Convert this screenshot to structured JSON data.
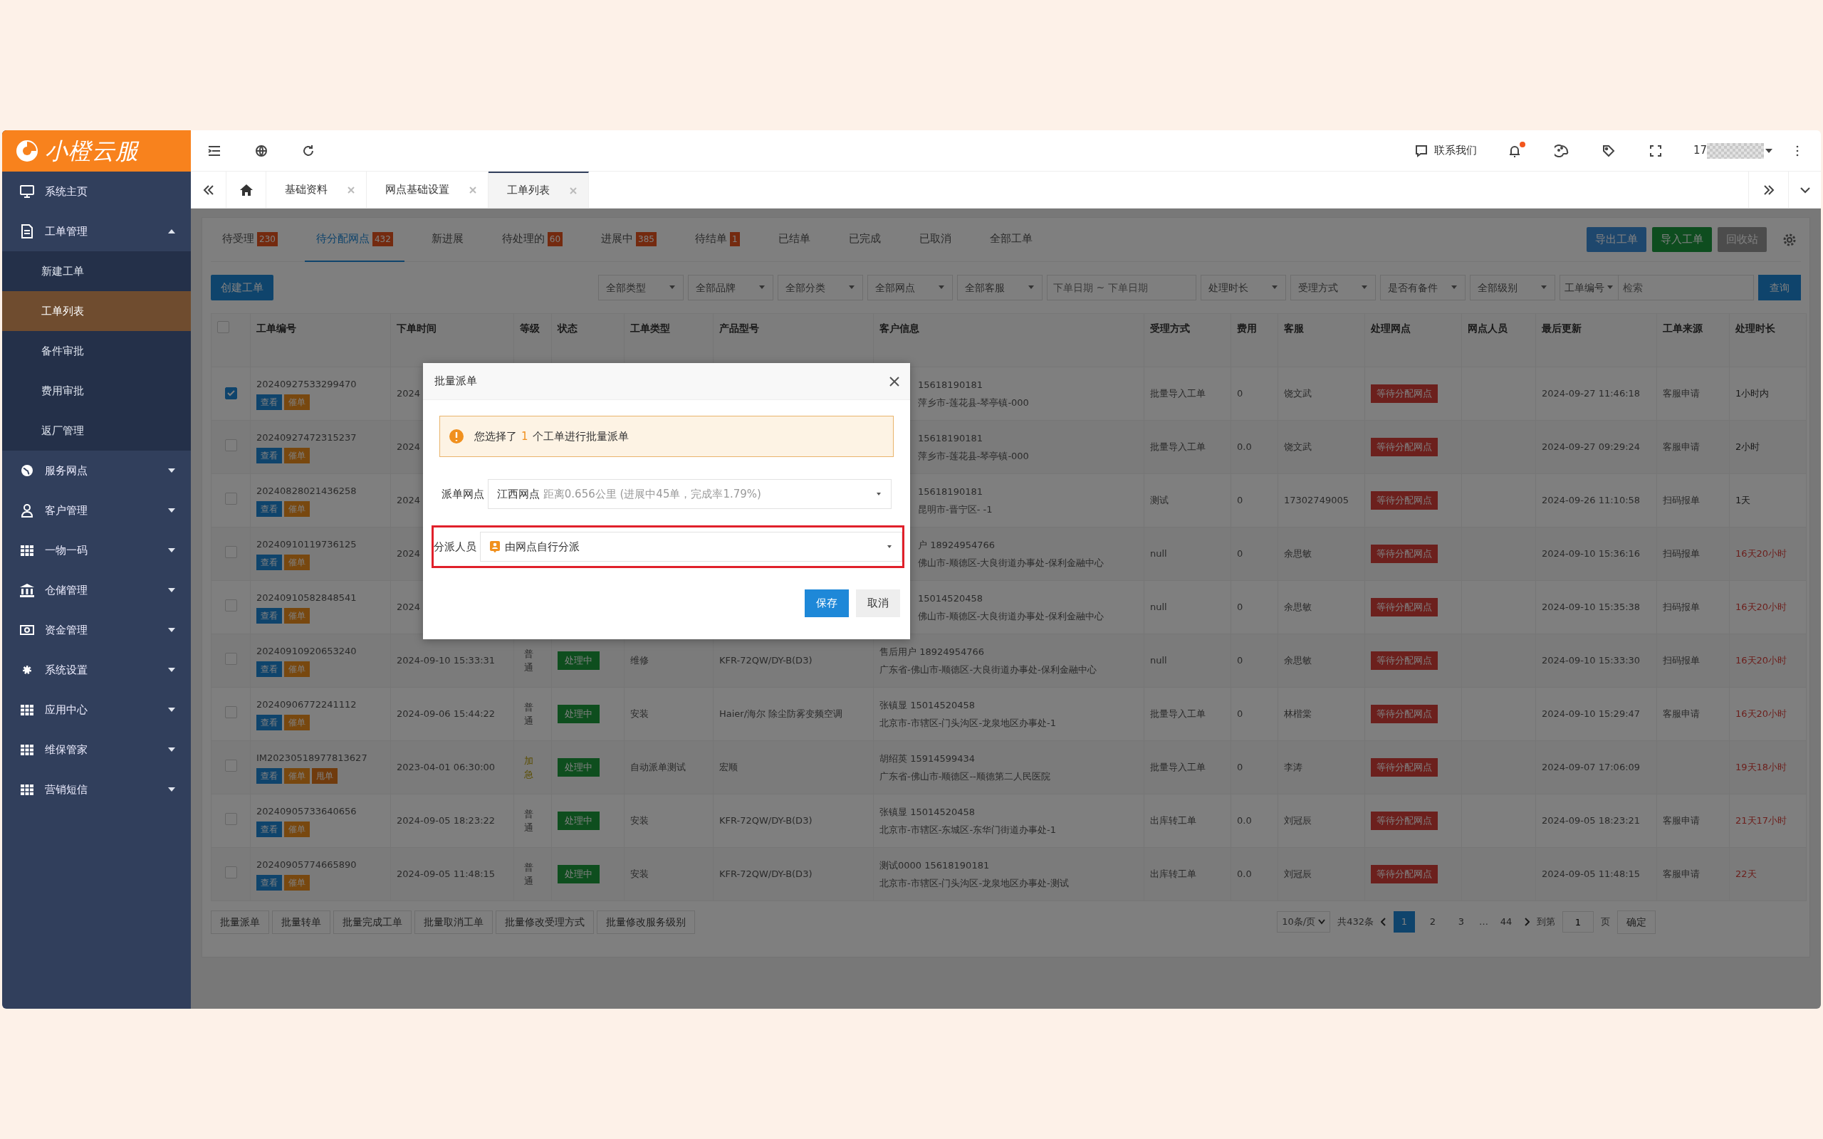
{
  "logo": {
    "text": "小橙云服"
  },
  "sidebar": {
    "items": [
      {
        "label": "系统主页"
      },
      {
        "label": "工单管理",
        "expanded": true,
        "children": [
          {
            "label": "新建工单",
            "selected": false
          },
          {
            "label": "工单列表",
            "selected": true
          },
          {
            "label": "备件审批",
            "selected": false
          },
          {
            "label": "费用审批",
            "selected": false
          },
          {
            "label": "返厂管理",
            "selected": false
          }
        ]
      },
      {
        "label": "服务网点",
        "expanded": false
      },
      {
        "label": "客户管理",
        "expanded": false
      },
      {
        "label": "一物一码",
        "expanded": false
      },
      {
        "label": "仓储管理",
        "expanded": false
      },
      {
        "label": "资金管理",
        "expanded": false
      },
      {
        "label": "系统设置",
        "expanded": false
      },
      {
        "label": "应用中心",
        "expanded": false
      },
      {
        "label": "维保管家",
        "expanded": false
      },
      {
        "label": "营销短信",
        "expanded": false
      }
    ]
  },
  "header": {
    "contact": "联系我们",
    "notification_dot": true,
    "user": "17"
  },
  "page_tabs": [
    {
      "label": "基础资料",
      "selected": false
    },
    {
      "label": "网点基础设置",
      "selected": false
    },
    {
      "label": "工单列表",
      "selected": true
    }
  ],
  "status_tabs": [
    {
      "label": "待受理",
      "count": "230",
      "selected": false
    },
    {
      "label": "待分配网点",
      "count": "432",
      "selected": true
    },
    {
      "label": "新进展",
      "selected": false
    },
    {
      "label": "待处理的",
      "count": "60",
      "selected": false
    },
    {
      "label": "进展中",
      "count": "385",
      "selected": false
    },
    {
      "label": "待结单",
      "count": "1",
      "selected": false
    },
    {
      "label": "已结单",
      "selected": false
    },
    {
      "label": "已完成",
      "selected": false
    },
    {
      "label": "已取消",
      "selected": false
    },
    {
      "label": "全部工单",
      "selected": false
    }
  ],
  "toolbar_buttons": [
    {
      "label": "导出工单",
      "kind": "export"
    },
    {
      "label": "导入工单",
      "kind": "import"
    },
    {
      "label": "回收站",
      "kind": "recycle"
    }
  ],
  "create_button": "创建工单",
  "filters": [
    {
      "label": "全部类型"
    },
    {
      "label": "全部品牌"
    },
    {
      "label": "全部分类"
    },
    {
      "label": "全部网点"
    },
    {
      "label": "全部客服"
    },
    {
      "placeholder": "下单日期 ~ 下单日期",
      "kind": "date"
    },
    {
      "label": "处理时长"
    },
    {
      "label": "受理方式"
    },
    {
      "label": "是否有备件"
    },
    {
      "label": "全部级别"
    }
  ],
  "search": {
    "field": "工单编号",
    "placeholder": "检索",
    "button": "查询"
  },
  "table": {
    "select_all_checked": false,
    "columns": [
      "工单编号",
      "下单时间",
      "等级",
      "状态",
      "工单类型",
      "产品型号",
      "客户信息",
      "受理方式",
      "费用",
      "客服",
      "处理网点",
      "网点人员",
      "最后更新",
      "工单来源",
      "处理时长"
    ],
    "rows": [
      {
        "checked": true,
        "covered": true,
        "number": "20240927533299470",
        "actions": [
          {
            "label": "查看",
            "kind": "view"
          },
          {
            "label": "催单",
            "kind": "remind"
          }
        ],
        "time": "2024",
        "customer": [
          "15618190181",
          "萍乡市-莲花县-琴亭镇-000"
        ],
        "method": "批量导入工单",
        "fee": "0",
        "agent": "饶文武",
        "site": "等待分配网点",
        "updated": "2024-09-27 11:46:18",
        "source": "客服申请",
        "duration": "1小时内",
        "overdue": false
      },
      {
        "checked": false,
        "covered": true,
        "number": "20240927472315237",
        "actions": [
          {
            "label": "查看",
            "kind": "view"
          },
          {
            "label": "催单",
            "kind": "remind"
          }
        ],
        "time": "2024",
        "customer": [
          "15618190181",
          "萍乡市-莲花县-琴亭镇-000"
        ],
        "method": "批量导入工单",
        "fee": "0.0",
        "agent": "饶文武",
        "site": "等待分配网点",
        "updated": "2024-09-27 09:29:24",
        "source": "客服申请",
        "duration": "2小时",
        "overdue": false
      },
      {
        "checked": false,
        "covered": true,
        "number": "20240828021436258",
        "actions": [
          {
            "label": "查看",
            "kind": "view"
          },
          {
            "label": "催单",
            "kind": "remind"
          }
        ],
        "time": "2024",
        "customer": [
          "15618190181",
          "昆明市-晋宁区- -1"
        ],
        "method": "测试",
        "fee": "0",
        "agent": "17302749005",
        "site": "等待分配网点",
        "updated": "2024-09-26 11:10:58",
        "source": "扫码报单",
        "duration": "1天",
        "overdue": false
      },
      {
        "checked": false,
        "covered": true,
        "number": "20240910119736125",
        "actions": [
          {
            "label": "查看",
            "kind": "view"
          },
          {
            "label": "催单",
            "kind": "remind"
          }
        ],
        "time": "2024",
        "customer": [
          "户 18924954766",
          "佛山市-顺德区-大良街道办事处-保利金融中心"
        ],
        "method": "null",
        "fee": "0",
        "agent": "余思敏",
        "site": "等待分配网点",
        "updated": "2024-09-10 15:36:16",
        "source": "扫码报单",
        "duration": "16天20小时",
        "overdue": true
      },
      {
        "checked": false,
        "covered": true,
        "number": "20240910582848541",
        "actions": [
          {
            "label": "查看",
            "kind": "view"
          },
          {
            "label": "催单",
            "kind": "remind"
          }
        ],
        "time": "2024",
        "customer": [
          "15014520458",
          "佛山市-顺德区-大良街道办事处-保利金融中心"
        ],
        "method": "null",
        "fee": "0",
        "agent": "余思敏",
        "site": "等待分配网点",
        "updated": "2024-09-10 15:35:38",
        "source": "扫码报单",
        "duration": "16天20小时",
        "overdue": true
      },
      {
        "checked": false,
        "covered": false,
        "number": "20240910920653240",
        "actions": [
          {
            "label": "查看",
            "kind": "view"
          },
          {
            "label": "催单",
            "kind": "remind"
          }
        ],
        "time": "2024-09-10 15:33:31",
        "priority": "普通",
        "urgent": false,
        "status": "处理中",
        "type": "维修",
        "model": "KFR-72QW/DY-B(D3)",
        "customer": [
          "售后用户 18924954766",
          "广东省-佛山市-顺德区-大良街道办事处-保利金融中心"
        ],
        "method": "null",
        "fee": "0",
        "agent": "余思敏",
        "site": "等待分配网点",
        "updated": "2024-09-10 15:33:30",
        "source": "扫码报单",
        "duration": "16天20小时",
        "overdue": true
      },
      {
        "checked": false,
        "covered": false,
        "number": "20240906772241112",
        "actions": [
          {
            "label": "查看",
            "kind": "view"
          },
          {
            "label": "催单",
            "kind": "remind"
          }
        ],
        "time": "2024-09-06 15:44:22",
        "priority": "普通",
        "urgent": false,
        "status": "处理中",
        "type": "安装",
        "model": "Haier/海尔 除尘防雾变频空调",
        "customer": [
          "张镇显 15014520458",
          "北京市-市辖区-门头沟区-龙泉地区办事处-1"
        ],
        "method": "批量导入工单",
        "fee": "0",
        "agent": "林楷棠",
        "site": "等待分配网点",
        "updated": "2024-09-10 15:29:47",
        "source": "客服申请",
        "duration": "16天20小时",
        "overdue": true
      },
      {
        "checked": false,
        "covered": false,
        "number": "IM20230518977813627",
        "actions": [
          {
            "label": "查看",
            "kind": "view"
          },
          {
            "label": "催单",
            "kind": "remind"
          },
          {
            "label": "甩单",
            "kind": "transfer"
          }
        ],
        "time": "2023-04-01 06:30:00",
        "priority": "加急",
        "urgent": true,
        "status": "处理中",
        "type": "自动派单测试",
        "model": "宏顺",
        "customer": [
          "胡绍英 15914599434",
          "广东省-佛山市-顺德区--顺德第二人民医院"
        ],
        "method": "批量导入工单",
        "fee": "0",
        "agent": "李涛",
        "site": "等待分配网点",
        "updated": "2024-09-07 17:06:09",
        "duration": "19天18小时",
        "overdue": true
      },
      {
        "checked": false,
        "covered": false,
        "number": "20240905733640656",
        "actions": [
          {
            "label": "查看",
            "kind": "view"
          },
          {
            "label": "催单",
            "kind": "remind"
          }
        ],
        "time": "2024-09-05 18:23:22",
        "priority": "普通",
        "urgent": false,
        "status": "处理中",
        "type": "安装",
        "model": "KFR-72QW/DY-B(D3)",
        "customer": [
          "张镇显 15014520458",
          "北京市-市辖区-东城区-东华门街道办事处-1"
        ],
        "method": "出库转工单",
        "fee": "0.0",
        "agent": "刘冠辰",
        "site": "等待分配网点",
        "updated": "2024-09-05 18:23:21",
        "source": "客服申请",
        "duration": "21天17小时",
        "overdue": true
      },
      {
        "checked": false,
        "covered": false,
        "number": "20240905774665890",
        "actions": [
          {
            "label": "查看",
            "kind": "view"
          },
          {
            "label": "催单",
            "kind": "remind"
          }
        ],
        "time": "2024-09-05 11:48:15",
        "priority": "普通",
        "urgent": false,
        "status": "处理中",
        "type": "安装",
        "model": "KFR-72QW/DY-B(D3)",
        "customer": [
          "测试0000 15618190181",
          "北京市-市辖区-门头沟区-龙泉地区办事处-测试"
        ],
        "method": "出库转工单",
        "fee": "0.0",
        "agent": "刘冠辰",
        "site": "等待分配网点",
        "updated": "2024-09-05 11:48:15",
        "source": "客服申请",
        "duration": "22天",
        "overdue": true
      }
    ]
  },
  "batch_buttons": [
    "批量派单",
    "批量转单",
    "批量完成工单",
    "批量取消工单",
    "批量修改受理方式",
    "批量修改服务级别"
  ],
  "pagination": {
    "page_size": "10条/页",
    "total": "共432条",
    "pages": [
      {
        "label": "1",
        "selected": true
      },
      {
        "label": "2",
        "selected": false
      },
      {
        "label": "3",
        "selected": false
      },
      {
        "label": "…",
        "kind": "gap"
      },
      {
        "label": "44",
        "selected": false
      }
    ],
    "goto_label": "到第",
    "goto_value": "1",
    "page_unit": "页",
    "confirm": "确定"
  },
  "dialog": {
    "title": "批量派单",
    "alert": {
      "before": "您选择了",
      "count": "1",
      "after": "个工单进行批量派单"
    },
    "fields": [
      {
        "label": "派单网点",
        "value": "江西网点",
        "hint": "距离0.656公里 (进展中45单，完成率1.79%)",
        "highlighted": false
      },
      {
        "label": "分派人员",
        "value": "由网点自行分派",
        "person_icon": true,
        "highlighted": true
      }
    ],
    "buttons": [
      {
        "label": "保存",
        "kind": "primary"
      },
      {
        "label": "取消",
        "kind": "secondary"
      }
    ]
  }
}
